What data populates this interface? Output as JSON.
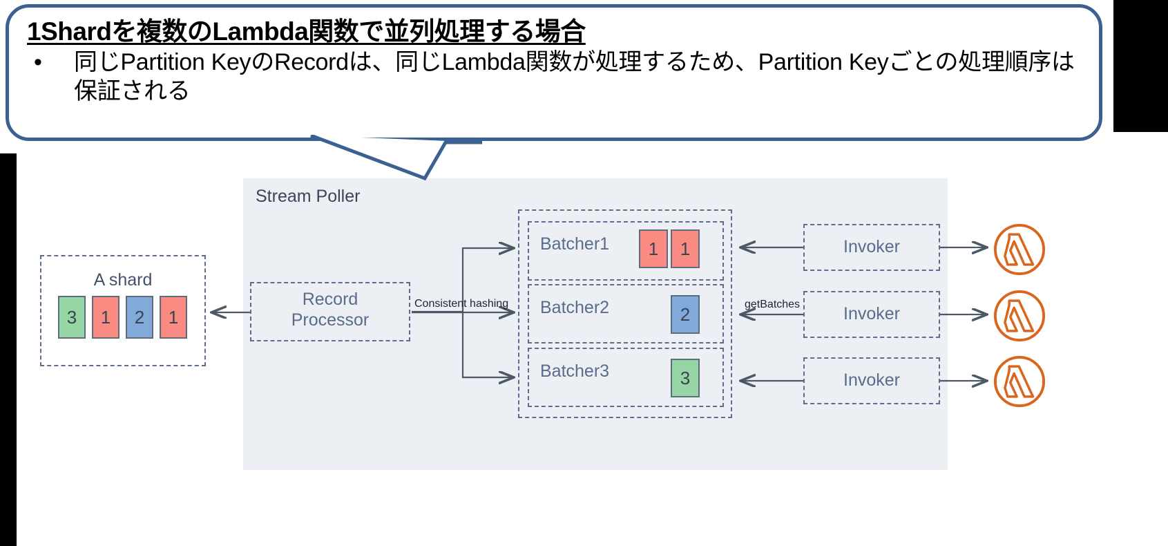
{
  "callout": {
    "title": "1Shardを複数のLambda関数で並列処理する場合",
    "bullet_marker": "•",
    "bullet_text": "同じPartition KeyのRecordは、同じLambda関数が処理するため、Partition Keyごとの処理順序は保証される"
  },
  "diagram": {
    "stream_poller_label": "Stream Poller",
    "shard": {
      "title": "A shard",
      "records": [
        {
          "value": "3",
          "color": "#96d5a4",
          "kind": "green"
        },
        {
          "value": "1",
          "color": "#f98b82",
          "kind": "red"
        },
        {
          "value": "2",
          "color": "#81aada",
          "kind": "blue"
        },
        {
          "value": "1",
          "color": "#f98b82",
          "kind": "red"
        }
      ]
    },
    "record_processor": {
      "line1": "Record",
      "line2": "Processor"
    },
    "edges": {
      "consistent_hashing": "Consistent hashing",
      "get_batches": "getBatches"
    },
    "batchers": [
      {
        "label": "Batcher1",
        "records": [
          {
            "value": "1",
            "kind": "red"
          },
          {
            "value": "1",
            "kind": "red"
          }
        ]
      },
      {
        "label": "Batcher2",
        "records": [
          {
            "value": "2",
            "kind": "blue"
          }
        ]
      },
      {
        "label": "Batcher3",
        "records": [
          {
            "value": "3",
            "kind": "green"
          }
        ]
      }
    ],
    "invokers": [
      {
        "label": "Invoker"
      },
      {
        "label": "Invoker"
      },
      {
        "label": "Invoker"
      }
    ],
    "lambda_icons": [
      {
        "name": "aws-lambda-icon"
      },
      {
        "name": "aws-lambda-icon"
      },
      {
        "name": "aws-lambda-icon"
      }
    ]
  },
  "colors": {
    "callout_border": "#3a6191",
    "panel_bg": "#eceff4",
    "dash_stroke": "#5d6c8a",
    "text_blue": "#5a6b8c",
    "lambda_orange": "#d9661f",
    "record_red": "#f98b82",
    "record_blue": "#81aada",
    "record_green": "#96d5a4"
  }
}
